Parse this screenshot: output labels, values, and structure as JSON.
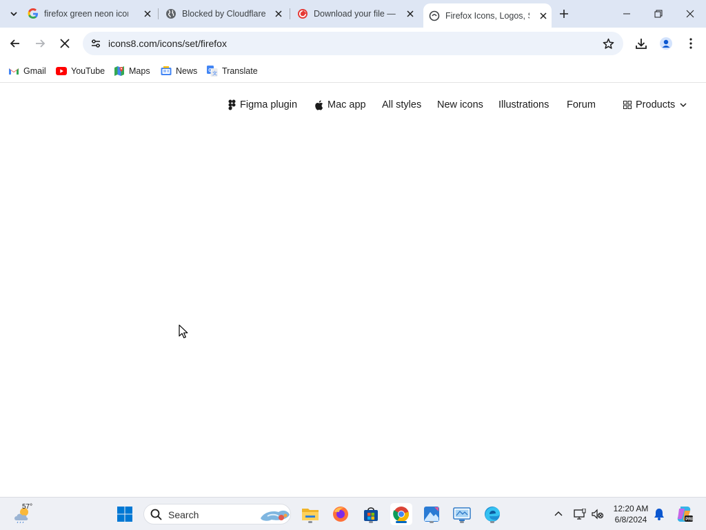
{
  "browser": {
    "tabs": [
      {
        "title": "firefox green neon icon",
        "favicon": "google-g-icon"
      },
      {
        "title": "Blocked by Cloudflare",
        "favicon": "globe-icon"
      },
      {
        "title": "Download your file —",
        "favicon": "red-swirl-icon"
      },
      {
        "title": "Firefox Icons, Logos, Sy",
        "favicon": "icons8-icon",
        "active": true
      }
    ],
    "address_url": "icons8.com/icons/set/firefox",
    "bookmarks": [
      {
        "label": "Gmail",
        "icon": "gmail-icon"
      },
      {
        "label": "YouTube",
        "icon": "youtube-icon"
      },
      {
        "label": "Maps",
        "icon": "maps-icon"
      },
      {
        "label": "News",
        "icon": "news-icon"
      },
      {
        "label": "Translate",
        "icon": "translate-icon"
      }
    ]
  },
  "site_nav": {
    "items": [
      {
        "label": "Figma plugin",
        "icon": "figma-icon"
      },
      {
        "label": "Mac app",
        "icon": "apple-icon"
      },
      {
        "label": "All styles"
      },
      {
        "label": "New icons"
      },
      {
        "label": "Illustrations"
      },
      {
        "label": "Forum"
      },
      {
        "label": "Products",
        "icon": "grid-icon"
      }
    ]
  },
  "taskbar": {
    "weather_temp": "57°",
    "search_label": "Search",
    "time": "12:20 AM",
    "date": "6/8/2024"
  },
  "colors": {
    "tabstrip": "#dee6f4",
    "omnibox": "#edf2fa",
    "taskbar": "#eef0f5",
    "accent": "#0067c0"
  }
}
